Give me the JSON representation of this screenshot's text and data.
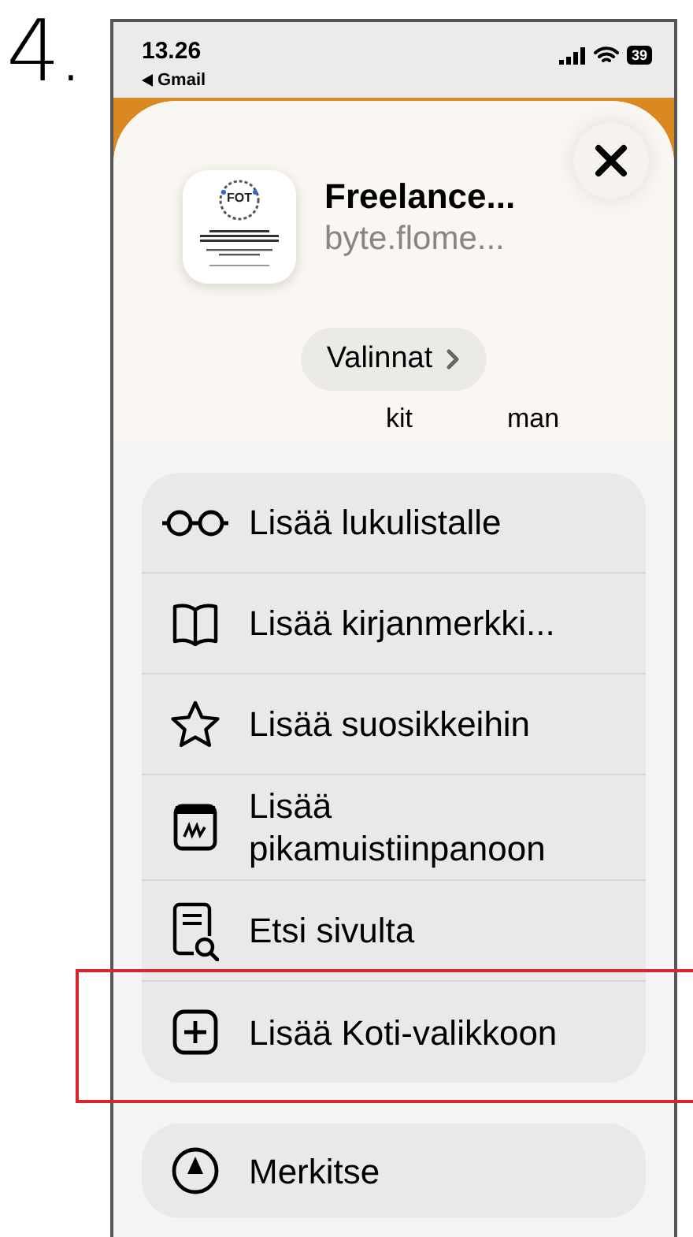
{
  "step_number": "4.",
  "status_bar": {
    "time": "13.26",
    "back_link": "Gmail",
    "battery": "39"
  },
  "share_header": {
    "app_icon_text": "FOT",
    "title": "Freelance...",
    "subtitle": "byte.flome..."
  },
  "options_button": {
    "label": "Valinnat"
  },
  "app_labels": [
    "kit",
    "man"
  ],
  "actions": [
    {
      "kind": "reading-list",
      "label": "Lisää lukulistalle",
      "highlighted": false
    },
    {
      "kind": "bookmark",
      "label": "Lisää kirjanmerkki...",
      "highlighted": false
    },
    {
      "kind": "favorite",
      "label": "Lisää suosikkeihin",
      "highlighted": false
    },
    {
      "kind": "quick-note",
      "label": "Lisää pikamuistiinpanoon",
      "highlighted": false
    },
    {
      "kind": "find",
      "label": "Etsi sivulta",
      "highlighted": false
    },
    {
      "kind": "home-screen",
      "label": "Lisää Koti-valikkoon",
      "highlighted": true
    }
  ],
  "next_actions": [
    {
      "kind": "markup",
      "label": "Merkitse"
    }
  ]
}
